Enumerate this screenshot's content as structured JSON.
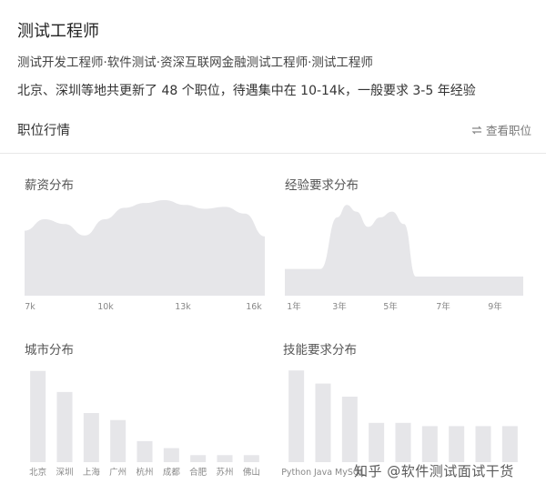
{
  "header": {
    "title": "测试工程师",
    "subtitle": "测试开发工程师·软件测试·资深互联网金融测试工程师·测试工程师",
    "summary": "北京、深圳等地共更新了 48 个职位，待遇集中在 10-14k，一般要求 3-5 年经验",
    "section_label": "职位行情",
    "view_jobs": "查看职位",
    "view_jobs_icon": "swap-arrows-icon"
  },
  "watermark": "知乎 @软件测试面试干货",
  "colors": {
    "fill": "#e6e6e9",
    "tick": "#888888",
    "divider": "#e8e8e8"
  },
  "chart_data": [
    {
      "id": "salary",
      "type": "area",
      "title": "薪资分布",
      "x": [
        7,
        7.75,
        8.5,
        9.25,
        10,
        10.75,
        11.5,
        12.25,
        13,
        13.75,
        14.5,
        15.25,
        16
      ],
      "y": [
        0.68,
        0.8,
        0.75,
        0.63,
        0.8,
        0.92,
        0.97,
        1.0,
        0.95,
        0.91,
        0.93,
        0.86,
        0.62
      ],
      "xticks": [
        "7k",
        "10k",
        "13k",
        "16k"
      ],
      "xlim": [
        7,
        16
      ],
      "ylim": [
        0,
        1
      ]
    },
    {
      "id": "experience",
      "type": "area",
      "title": "经验要求分布",
      "x": [
        0,
        1,
        1.5,
        2.2,
        2.6,
        3,
        3.5,
        4,
        4.5,
        5,
        5.5,
        6,
        7,
        8,
        9,
        10
      ],
      "y": [
        0.28,
        0.28,
        0.28,
        0.82,
        0.95,
        0.88,
        0.72,
        0.82,
        0.88,
        0.75,
        0.2,
        0.2,
        0.2,
        0.2,
        0.2,
        0.2
      ],
      "xticks": [
        "1年",
        "3年",
        "5年",
        "7年",
        "9年"
      ],
      "xlim": [
        0,
        10
      ],
      "ylim": [
        0,
        1
      ]
    },
    {
      "id": "city",
      "type": "bar",
      "title": "城市分布",
      "categories": [
        "北京",
        "深圳",
        "上海",
        "广州",
        "杭州",
        "成都",
        "合肥",
        "苏州",
        "佛山"
      ],
      "values": [
        13,
        10,
        7,
        6,
        3,
        2,
        1,
        1,
        1
      ],
      "ylim": [
        0,
        14
      ]
    },
    {
      "id": "skill",
      "type": "bar",
      "title": "技能要求分布",
      "categories": [
        "Python",
        "Java",
        "MySQL",
        "",
        "",
        "",
        "",
        "",
        ""
      ],
      "values": [
        14,
        12,
        10,
        6,
        6,
        5.5,
        5.5,
        5.5,
        5.5
      ],
      "ylim": [
        0,
        15
      ]
    }
  ]
}
